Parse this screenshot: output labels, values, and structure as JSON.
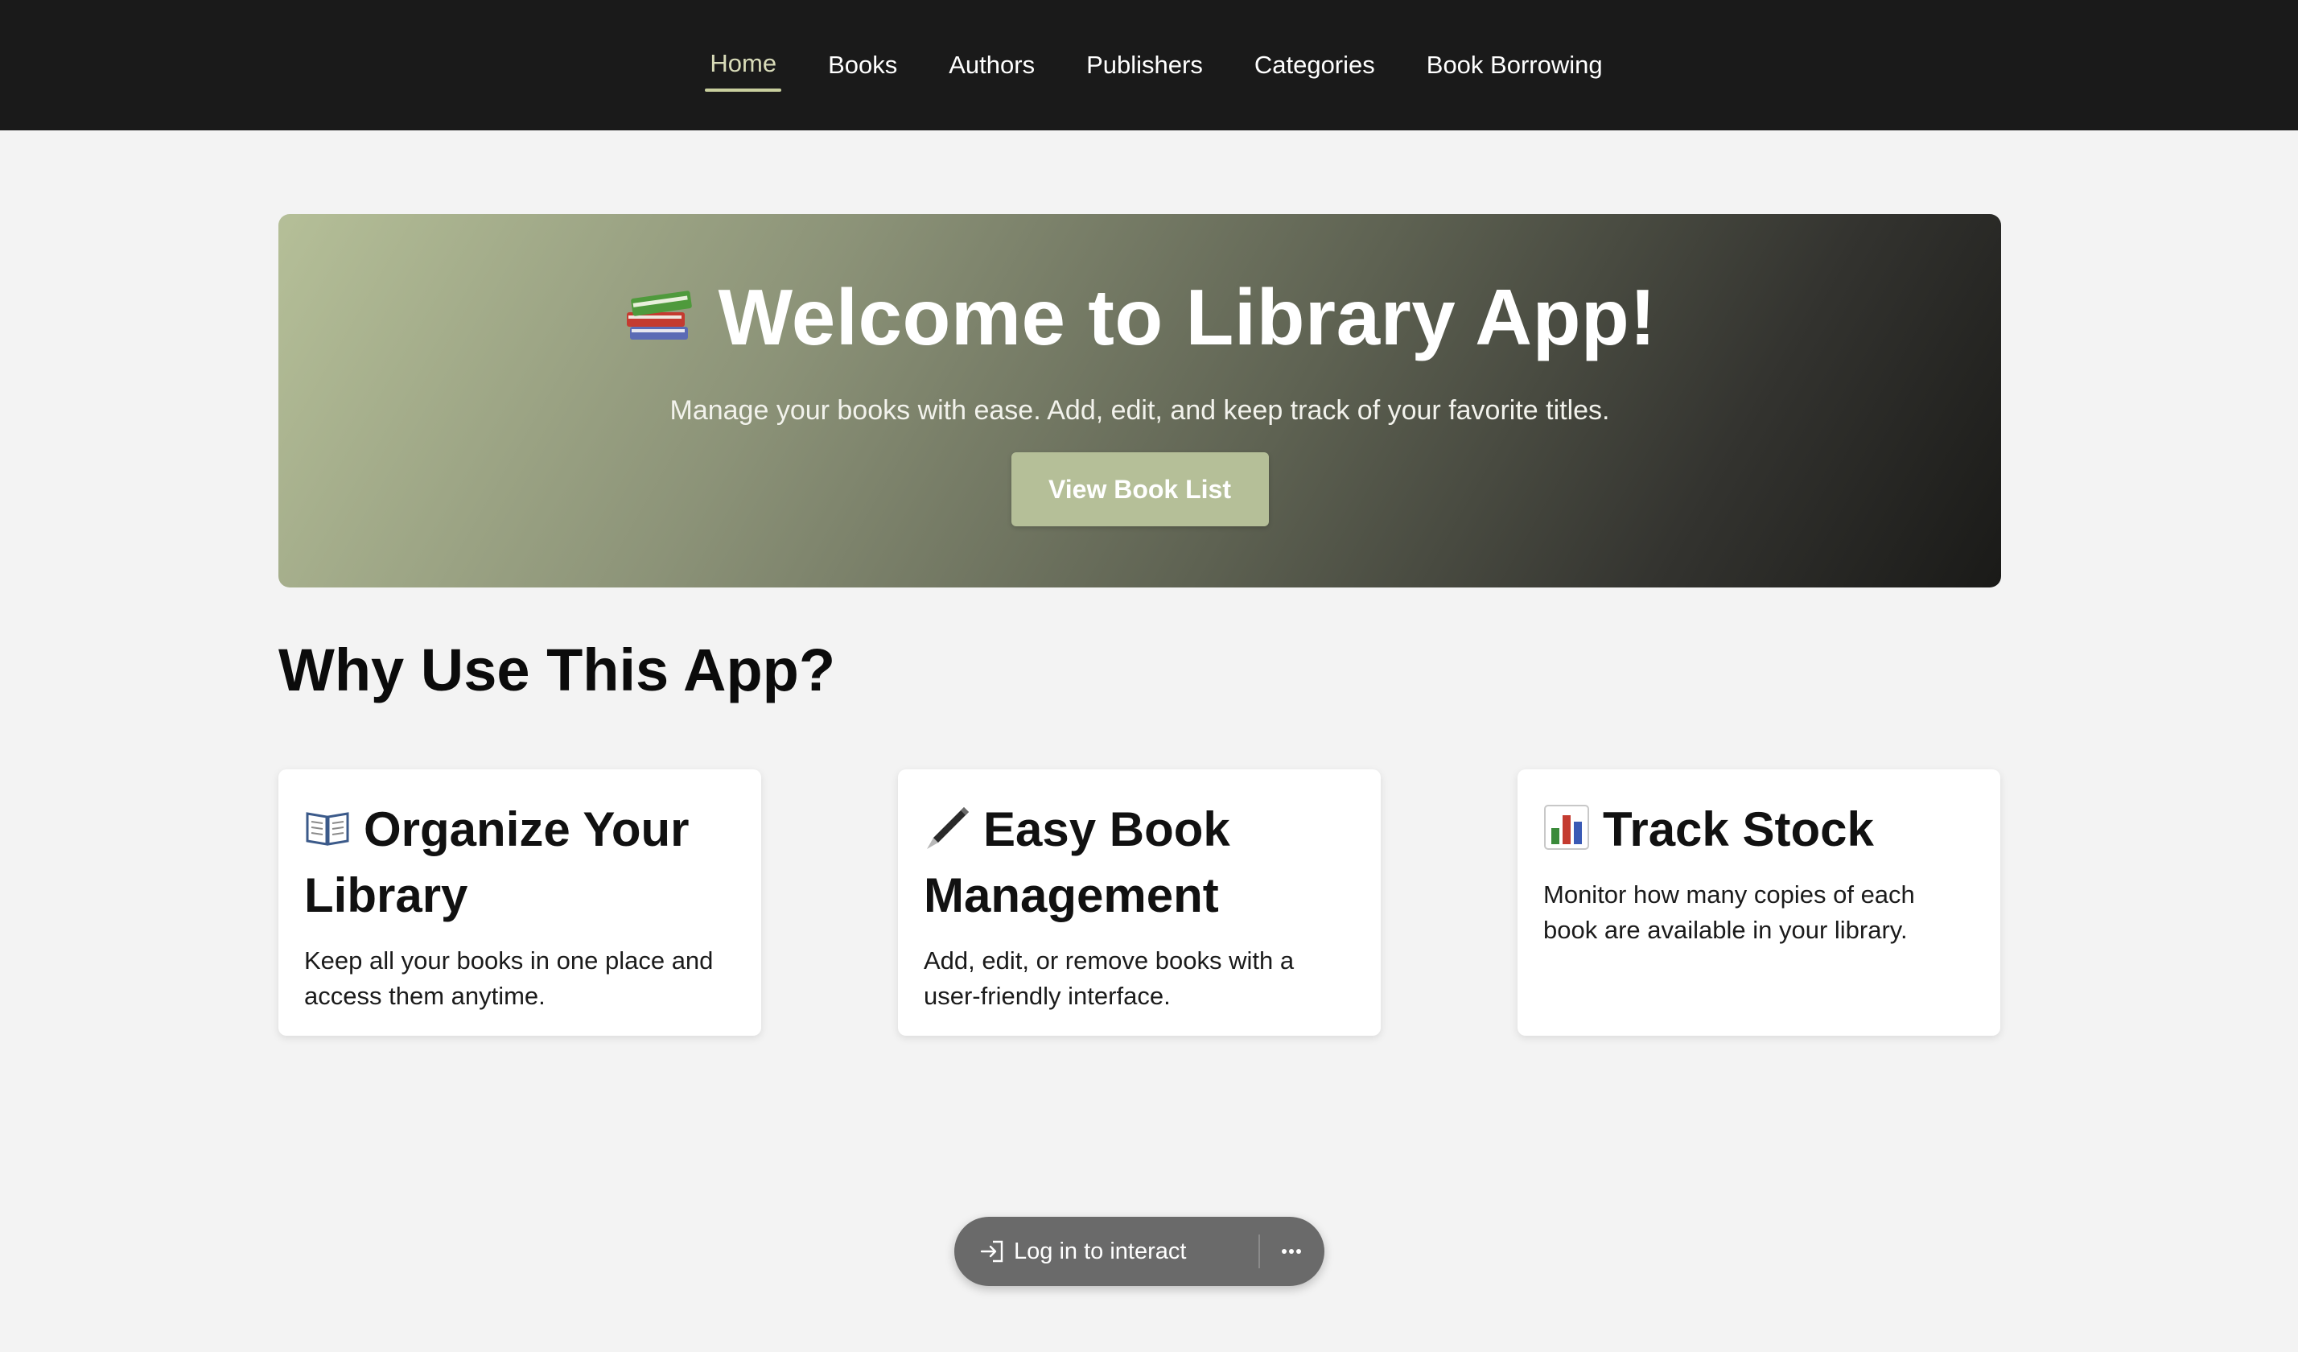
{
  "nav": {
    "items": [
      {
        "label": "Home",
        "active": true
      },
      {
        "label": "Books",
        "active": false
      },
      {
        "label": "Authors",
        "active": false
      },
      {
        "label": "Publishers",
        "active": false
      },
      {
        "label": "Categories",
        "active": false
      },
      {
        "label": "Book Borrowing",
        "active": false
      }
    ]
  },
  "hero": {
    "icon": "books-icon",
    "title": "Welcome to Library App!",
    "subtitle": "Manage your books with ease. Add, edit, and keep track of your favorite titles.",
    "button_label": "View Book List"
  },
  "features": {
    "heading": "Why Use This App?",
    "cards": [
      {
        "icon": "open-book-icon",
        "title": "Organize Your Library",
        "description": "Keep all your books in one place and access them anytime."
      },
      {
        "icon": "pen-icon",
        "title": "Easy Book Management",
        "description": "Add, edit, or remove books with a user-friendly interface."
      },
      {
        "icon": "bar-chart-icon",
        "title": "Track Stock",
        "description": "Monitor how many copies of each book are available in your library."
      }
    ]
  },
  "login_pill": {
    "icon": "log-in-icon",
    "label": "Log in to interact",
    "more_icon": "more-icon"
  },
  "colors": {
    "nav_bg": "#1a1a1a",
    "accent": "#b5bf98",
    "page_bg": "#f3f3f3",
    "active_nav": "#d8dbb8"
  }
}
